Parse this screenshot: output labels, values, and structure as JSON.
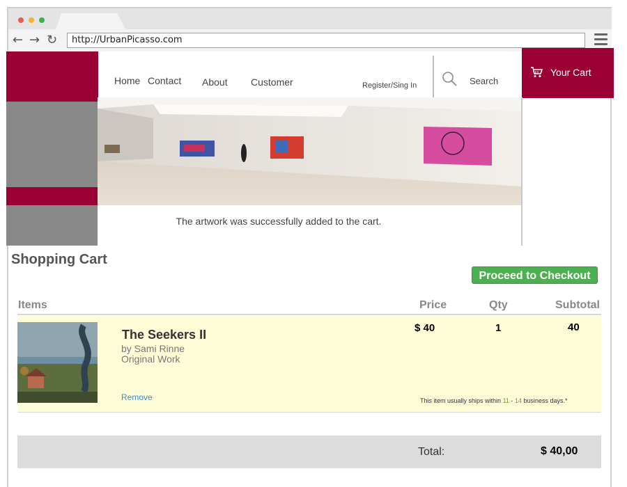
{
  "browser": {
    "url": "http://UrbanPicasso.com"
  },
  "nav": {
    "home": "Home",
    "contact": "Contact",
    "about": "About",
    "customer": "Customer",
    "register": "Register/Sing In",
    "search": "Search",
    "cart": "Your Cart"
  },
  "message": "The artwork was successfully added to the cart.",
  "cart": {
    "title": "Shopping Cart",
    "checkout_label": "Proceed to Checkout",
    "headers": {
      "items": "Items",
      "price": "Price",
      "qty": "Qty",
      "subtotal": "Subtotal"
    },
    "item": {
      "title": "The Seekers II",
      "artist": "by Sami Rinne",
      "type": "Original Work",
      "price": "$ 40",
      "qty": "1",
      "subtotal": "40",
      "remove": "Remove",
      "ship_prefix": "This item usually ships within",
      "ship_from": "11",
      "ship_sep": "-",
      "ship_to": "14",
      "ship_suffix": "business days.*"
    },
    "total_label": "Total:",
    "total_value": "$ 40,00"
  },
  "colors": {
    "brand": "#9b0034",
    "checkout": "#4caf50",
    "row_bg": "#fffdd8",
    "link": "#3a8fc9"
  }
}
